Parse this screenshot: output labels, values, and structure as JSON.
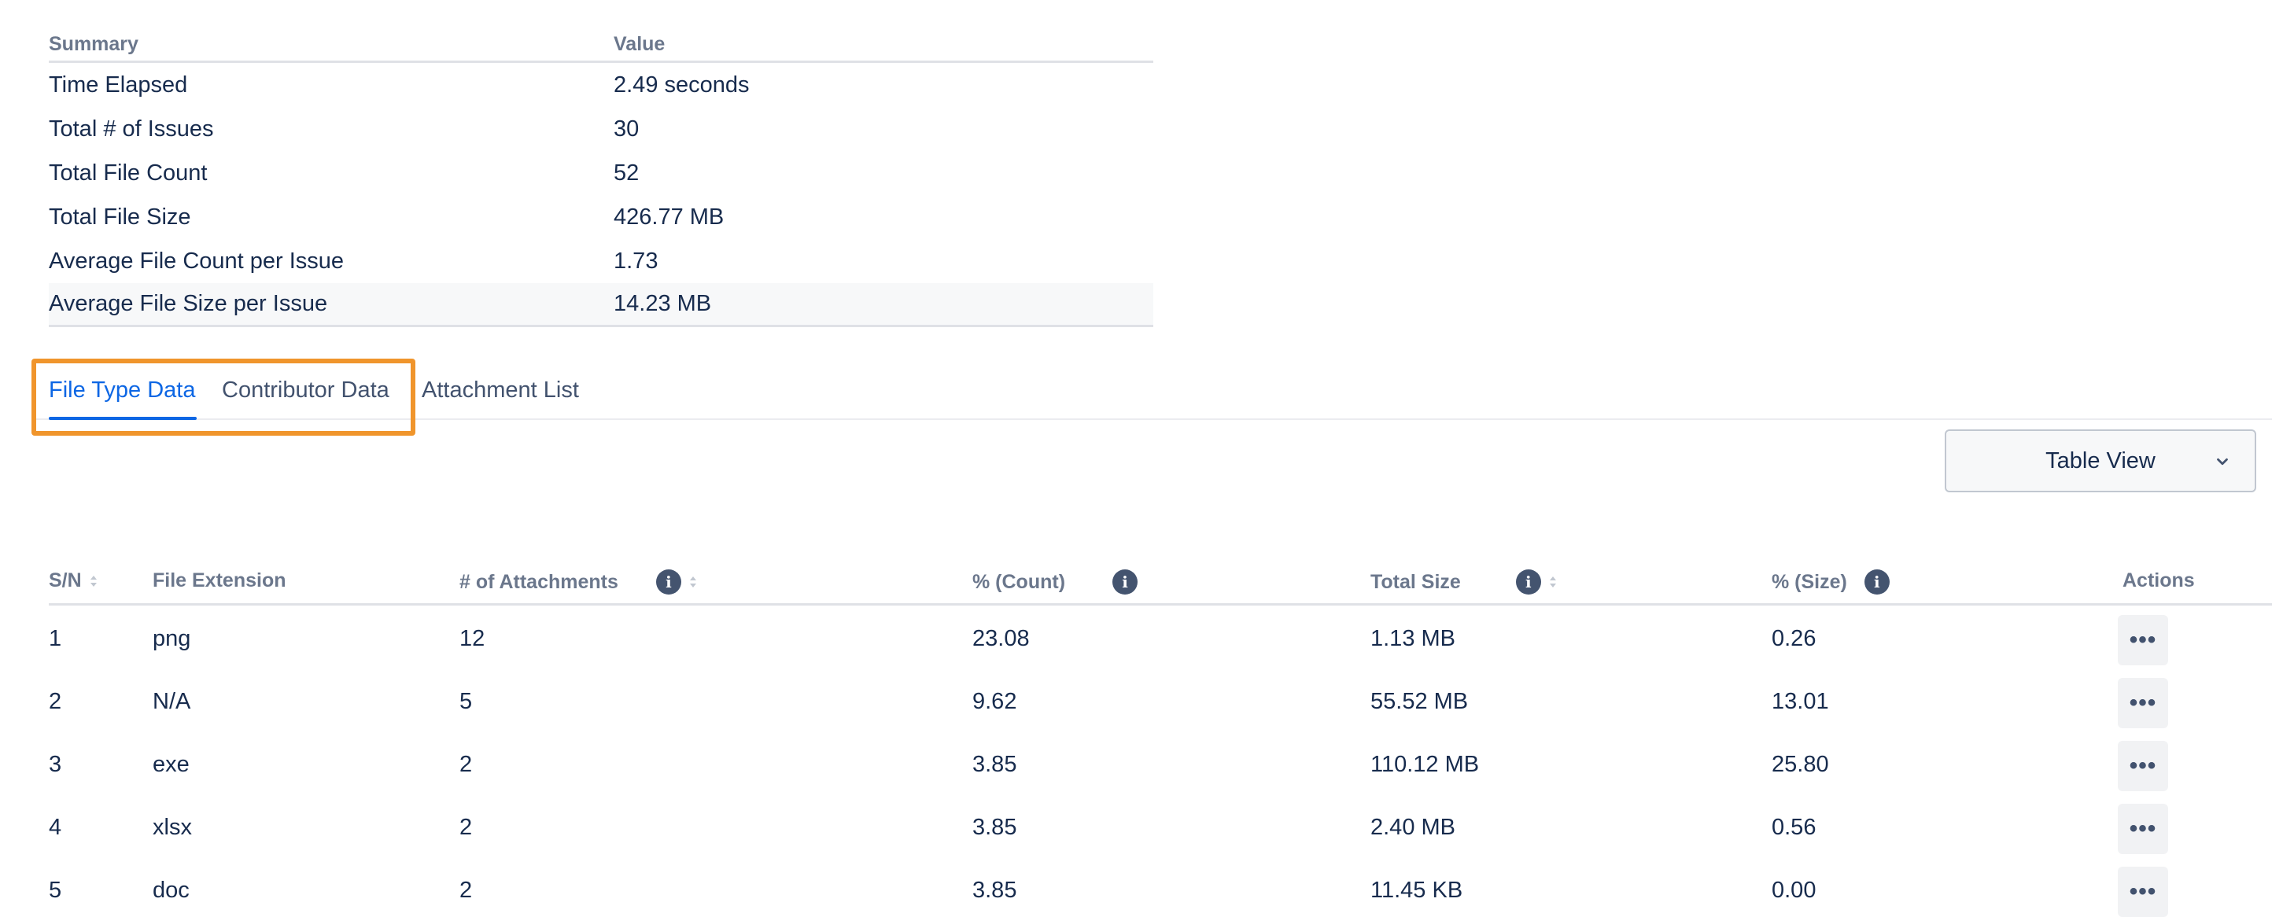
{
  "summary": {
    "headers": {
      "summary": "Summary",
      "value": "Value"
    },
    "rows": [
      {
        "label": "Time Elapsed",
        "value": "2.49 seconds"
      },
      {
        "label": "Total # of Issues",
        "value": "30"
      },
      {
        "label": "Total File Count",
        "value": "52"
      },
      {
        "label": "Total File Size",
        "value": "426.77 MB"
      },
      {
        "label": "Average File Count per Issue",
        "value": "1.73"
      },
      {
        "label": "Average File Size per Issue",
        "value": "14.23 MB"
      }
    ]
  },
  "tabs": [
    {
      "label": "File Type Data",
      "active": true
    },
    {
      "label": "Contributor Data",
      "active": false
    },
    {
      "label": "Attachment List",
      "active": false
    }
  ],
  "view_select": {
    "value": "Table View"
  },
  "table": {
    "headers": {
      "sn": "S/N",
      "ext": "File Extension",
      "attachments": "# of Attachments",
      "pct_count": "% (Count)",
      "total_size": "Total Size",
      "pct_size": "% (Size)",
      "actions": "Actions"
    },
    "action_glyph": "•••",
    "rows": [
      {
        "sn": "1",
        "ext": "png",
        "attachments": "12",
        "pct_count": "23.08",
        "total_size": "1.13 MB",
        "pct_size": "0.26"
      },
      {
        "sn": "2",
        "ext": "N/A",
        "attachments": "5",
        "pct_count": "9.62",
        "total_size": "55.52 MB",
        "pct_size": "13.01"
      },
      {
        "sn": "3",
        "ext": "exe",
        "attachments": "2",
        "pct_count": "3.85",
        "total_size": "110.12 MB",
        "pct_size": "25.80"
      },
      {
        "sn": "4",
        "ext": "xlsx",
        "attachments": "2",
        "pct_count": "3.85",
        "total_size": "2.40 MB",
        "pct_size": "0.56"
      },
      {
        "sn": "5",
        "ext": "doc",
        "attachments": "2",
        "pct_count": "3.85",
        "total_size": "11.45 KB",
        "pct_size": "0.00"
      }
    ]
  },
  "colors": {
    "accent": "#0c66e4",
    "highlight": "#f0952c",
    "info_icon": "#44546f"
  }
}
